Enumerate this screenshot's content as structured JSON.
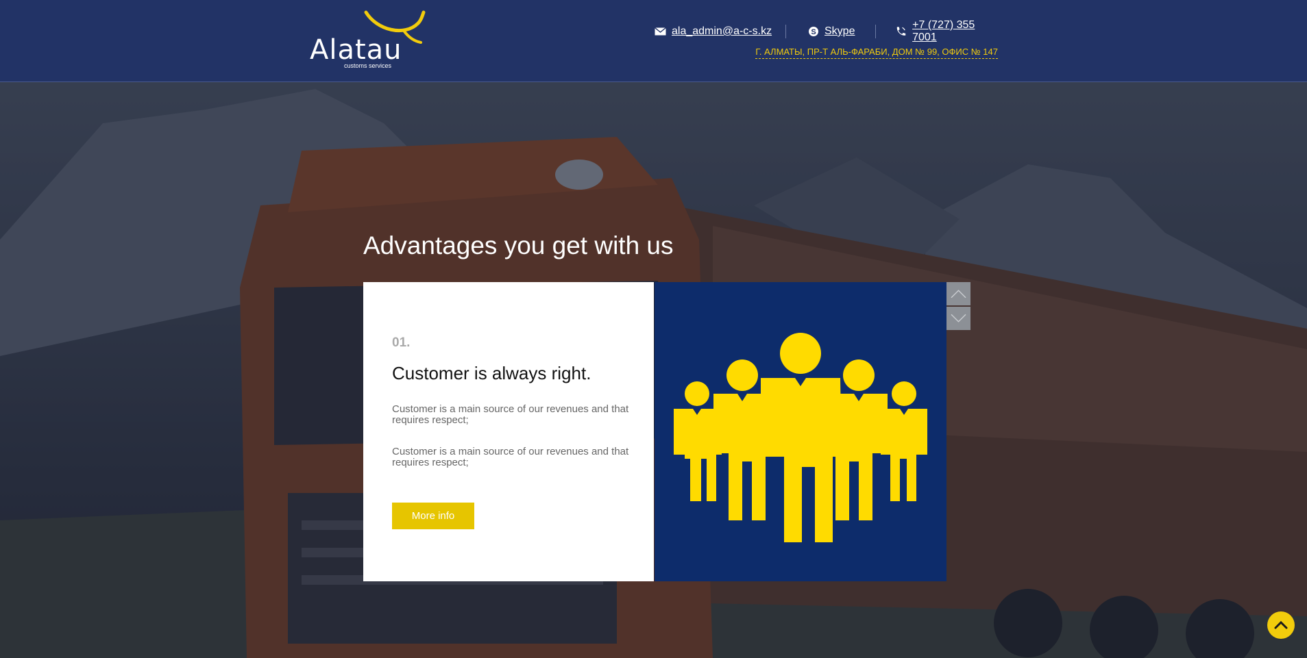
{
  "header": {
    "logo_text": "Alatau",
    "logo_subtext": "customs services",
    "email": "ala_admin@a-c-s.kz",
    "skype": "Skype",
    "phone": "+7 (727) 355 7001",
    "address": "Г. АЛМАТЫ, ПР-Т АЛЬ-ФАРАБИ, ДОМ № 99, ОФИС № 147"
  },
  "icons": {
    "email": "envelope-icon",
    "skype": "skype-icon",
    "phone": "phone-icon",
    "slider_prev": "chevron-up-icon",
    "slider_next": "chevron-down-icon",
    "scroll_top": "chevron-up-icon",
    "illustration": "people-group-icon"
  },
  "advantages": {
    "title": "Advantages you get with us",
    "item": {
      "number": "01.",
      "title": "Customer is always right.",
      "paragraphs": [
        "Customer is a main source of our revenues and that requires respect;",
        "Customer is a main source of our revenues and that requires respect;"
      ],
      "button_label": "More info"
    }
  },
  "colors": {
    "header_bg": "#223366",
    "accent_yellow": "#f2cc0c",
    "button_yellow": "#e6c500",
    "panel_blue": "#0d2c6b",
    "figure_yellow": "#ffdb00"
  }
}
